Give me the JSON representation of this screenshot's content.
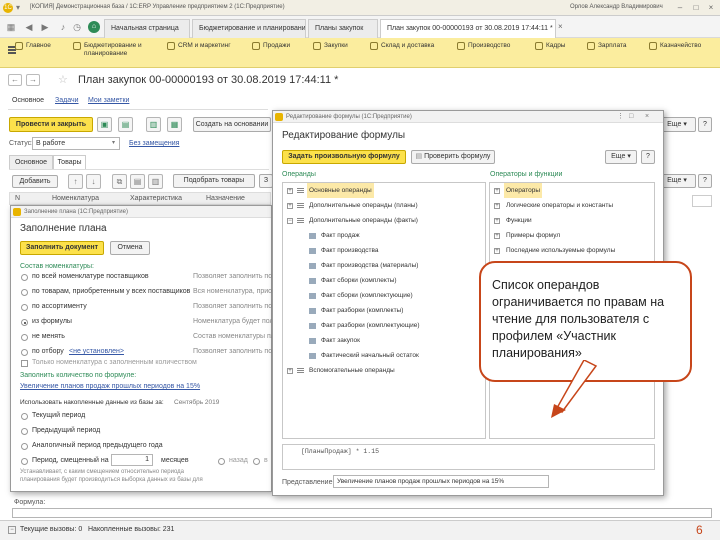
{
  "window": {
    "title": "[КОПИЯ] Демонстрационная база / 1С:ERP Управление предприятием 2  (1С:Предприятие)",
    "user": "Орлов Александр Владимирович"
  },
  "page_tabs": [
    "Начальная страница",
    "Бюджетирование и планирование",
    "Планы закупок",
    "План закупок 00-00000193 от 30.08.2019 17:44:11 *"
  ],
  "sections": [
    {
      "label": "Главное"
    },
    {
      "label": "Бюджетирование и планирование"
    },
    {
      "label": "CRM и маркетинг"
    },
    {
      "label": "Продажи"
    },
    {
      "label": "Закупки"
    },
    {
      "label": "Склад и доставка"
    },
    {
      "label": "Производство"
    },
    {
      "label": "Кадры"
    },
    {
      "label": "Зарплата"
    },
    {
      "label": "Казначейство"
    }
  ],
  "doc": {
    "title": "План закупок 00-00000193 от 30.08.2019 17:44:11 *",
    "nav": [
      "Основное",
      "Задачи",
      "Мои заметки"
    ],
    "post_close": "Провести и закрыть",
    "create_based": "Создать на основании",
    "status_label": "Статус:",
    "status_value": "В работе",
    "no_replacements": "Без замещения",
    "tabs": [
      "Основное",
      "Товары"
    ],
    "add": "Добавить",
    "pick_goods": "Подобрать товары",
    "columns": [
      "N",
      "Номенклатура",
      "Характеристика",
      "Назначение"
    ],
    "formula_label": "Формула:",
    "more": "Еще"
  },
  "fill": {
    "window_title": "Заполнение плана  (1С:Предприятие)",
    "title": "Заполнение плана",
    "fill_doc": "Заполнить документ",
    "cancel": "Отмена",
    "composition_title": "Состав номенклатуры:",
    "options": [
      {
        "label": "по всей номенклатуре поставщиков",
        "hint": "Позволяет заполнить по з"
      },
      {
        "label": "по товарам, приобретенным у всех поставщиков",
        "hint": "Вся номенклатура, приоб"
      },
      {
        "label": "по ассортименту",
        "hint": "Позволяет заполнить по"
      },
      {
        "label": "из формулы",
        "hint": "Номенклатура будет пол"
      },
      {
        "label": "не менять",
        "hint": "Состав номенклатуры пл"
      },
      {
        "label": "по отбору",
        "link": "<не установлен>",
        "hint": "Позволяет заполнить по"
      }
    ],
    "only_with_qty": "Только номенклатура с заполненным количеством",
    "qty_title": "Заполнить количество по формуле:",
    "qty_link": "Увеличение планов продаж прошлых периодов на 15%",
    "accum_label": "Использовать накопленные данные из базы за:",
    "accum_value": "Сентябрь 2019",
    "periods": [
      "Текущий период",
      "Предыдущий период",
      "Аналогичный период предыдущего года",
      "Период, смещенный на"
    ],
    "shift_value": "1",
    "shift_unit": "месяцев",
    "back": "назад",
    "forward": "в",
    "shift_hint": [
      "Устанавливает, с каким смещением относительно периода",
      "планирования будет производиться выборка данных из базы для"
    ]
  },
  "formula": {
    "window_title": "Редактирование формулы  (1С:Предприятие)",
    "title": "Редактирование формулы",
    "set_formula": "Задать произвольную формулу",
    "check_formula": "Проверить формулу",
    "more": "Еще",
    "help": "?",
    "operands_title": "Операнды",
    "operators_title": "Операторы и функции",
    "operands": [
      {
        "label": "Основные операнды",
        "level": 0,
        "selected": true
      },
      {
        "label": "Дополнительные операнды (планы)",
        "level": 0
      },
      {
        "label": "Дополнительные операнды (факты)",
        "level": 0
      },
      {
        "label": "Факт продаж",
        "level": 1
      },
      {
        "label": "Факт производства",
        "level": 1
      },
      {
        "label": "Факт производства (материалы)",
        "level": 1
      },
      {
        "label": "Факт сборки (комплекты)",
        "level": 1
      },
      {
        "label": "Факт сборки (комплектующие)",
        "level": 1
      },
      {
        "label": "Факт разборки (комплекты)",
        "level": 1
      },
      {
        "label": "Факт разборки (комплектующие)",
        "level": 1
      },
      {
        "label": "Факт закупок",
        "level": 1
      },
      {
        "label": "Фактический начальный остаток",
        "level": 1
      },
      {
        "label": "Вспомогательные операнды",
        "level": 0
      }
    ],
    "operators": [
      {
        "label": "Операторы",
        "selected": true
      },
      {
        "label": "Логические операторы и константы"
      },
      {
        "label": "Функции"
      },
      {
        "label": "Примеры формул"
      },
      {
        "label": "Последние используемые формулы"
      }
    ],
    "expression": "[ПланыПродаж] * 1.15",
    "presentation_label": "Представление:",
    "presentation_value": "Увеличение планов продаж прошлых периодов на 15%"
  },
  "callout": "Список операндов ограничивается по правам на чтение для пользователя с профилем «Участник планирования»",
  "status_bar": {
    "current": "Текущие вызовы: 0",
    "accumulated": "Накопленные вызовы: 231"
  },
  "slide_number": "6",
  "colors": {
    "section_bar": "#fbed9e",
    "yellow_button": "#fce14b",
    "green_title": "#2e8b57",
    "callout_border": "#c7461a",
    "link": "#3557a5"
  }
}
